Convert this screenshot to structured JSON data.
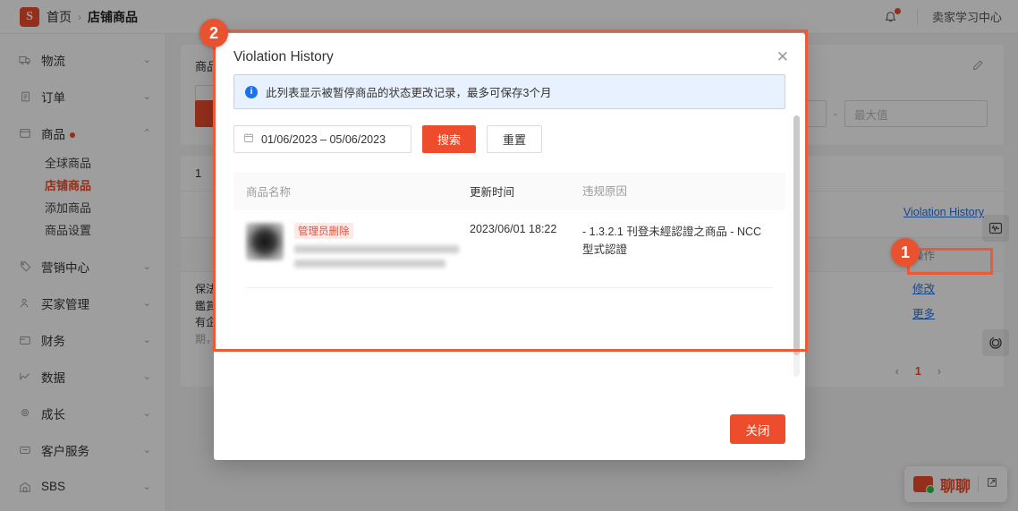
{
  "topbar": {
    "logo_glyph": "S",
    "breadcrumb_home": "首页",
    "breadcrumb_sep": "›",
    "breadcrumb_current": "店铺商品",
    "bell_icon": "bell-icon",
    "seller_center_link": "卖家学习中心"
  },
  "sidebar": {
    "items": [
      {
        "label": "物流",
        "icon": "truck-icon",
        "chevron": "⌄",
        "dot": false
      },
      {
        "label": "订单",
        "icon": "clipboard-icon",
        "chevron": "⌄",
        "dot": false
      },
      {
        "label": "商品",
        "icon": "box-icon",
        "chevron": "⌃",
        "dot": true
      }
    ],
    "product_subitems": [
      {
        "label": "全球商品",
        "active": false
      },
      {
        "label": "店铺商品",
        "active": true
      },
      {
        "label": "添加商品",
        "active": false
      },
      {
        "label": "商品设置",
        "active": false
      }
    ],
    "items_lower": [
      {
        "label": "营销中心",
        "icon": "tag-icon",
        "chevron": "⌄"
      },
      {
        "label": "买家管理",
        "icon": "users-icon",
        "chevron": "⌄"
      },
      {
        "label": "财务",
        "icon": "wallet-icon",
        "chevron": "⌄"
      },
      {
        "label": "数据",
        "icon": "chart-icon",
        "chevron": "⌄"
      },
      {
        "label": "成长",
        "icon": "medal-icon",
        "chevron": "⌄"
      },
      {
        "label": "客户服务",
        "icon": "chat-icon",
        "chevron": "⌄"
      },
      {
        "label": "SBS",
        "icon": "warehouse-icon",
        "chevron": "⌄"
      }
    ]
  },
  "background_page": {
    "filter_label": "商品",
    "max_value_placeholder": "最大值",
    "range_dash": "-",
    "pencil_icon": "pencil-icon",
    "list_count": "1",
    "violation_history_link": "Violation History",
    "table_header_operation": "操作",
    "row_text_lines": [
      "保法調整您的退貨說",
      "鑑賞期並由賣家負擔退",
      "有企業經營者皆須提",
      "期，蝦皮商城依平台"
    ],
    "op_links": [
      "修改",
      "更多"
    ],
    "pagination": {
      "prev": "‹",
      "current": "1",
      "next": "›"
    },
    "rail_icons": [
      "pulse-icon",
      "loading-ring-icon"
    ],
    "chat_widget": {
      "label": "聊聊",
      "expand_icon": "expand-icon",
      "chat_icon": "chat-bubble-icon"
    }
  },
  "modal": {
    "title": "Violation History",
    "close_icon": "close-icon",
    "alert": {
      "icon": "info-icon",
      "text": "此列表显示被暂停商品的状态更改记录，最多可保存3个月"
    },
    "date_range": {
      "icon": "calendar-icon",
      "value": "01/06/2023 – 05/06/2023"
    },
    "search_button": "搜索",
    "reset_button": "重置",
    "table": {
      "columns": [
        "商品名称",
        "更新时间",
        "违规原因"
      ],
      "rows": [
        {
          "thumbnail": "product-thumbnail",
          "status_badge": "管理员删除",
          "name_redacted": true,
          "updated_at": "2023/06/01 18:22",
          "reason": "- 1.3.2.1 刊登未經認證之商品 - NCC 型式認證"
        }
      ]
    },
    "footer_close_button": "关闭"
  },
  "annotations": {
    "markers": [
      {
        "number": "1",
        "target": "violation-history-link"
      },
      {
        "number": "2",
        "target": "violation-history-modal"
      }
    ],
    "highlight_color": "#ec5b35"
  }
}
